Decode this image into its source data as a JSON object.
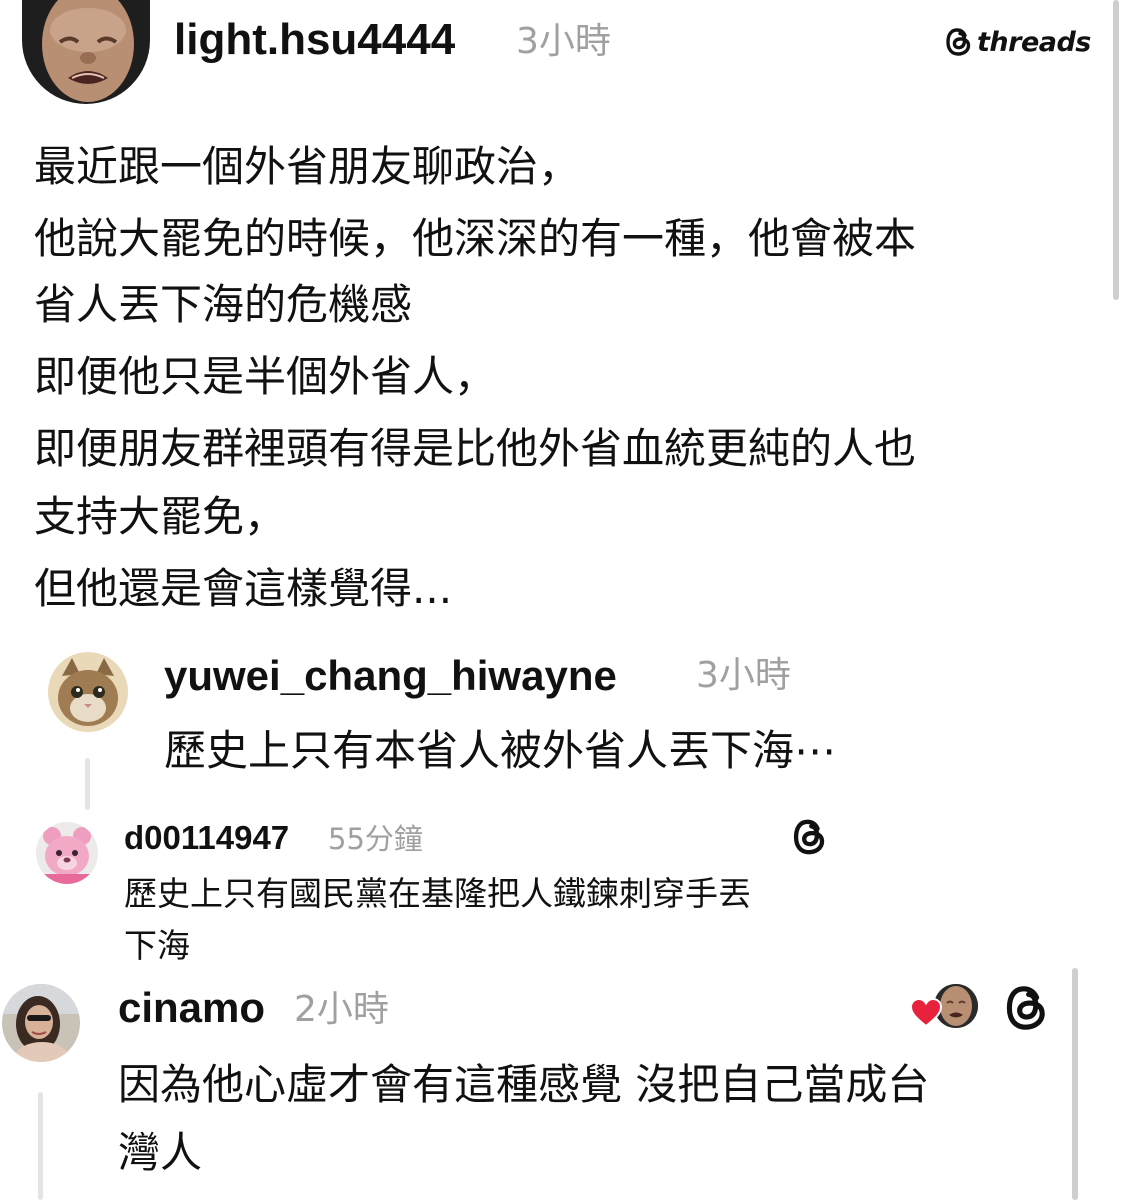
{
  "brand": {
    "icon": "threads-logo-icon",
    "label": "threads"
  },
  "post": {
    "author": "light.hsu4444",
    "time": "3小時",
    "avatar": "crying-baby-avatar",
    "lines": [
      "最近跟一個外省朋友聊政治，",
      "他說大罷免的時候，他深深的有一種，他會被本",
      "省人丟下海的危機感",
      "即便他只是半個外省人，",
      "即便朋友群裡頭有得是比他外省血統更純的人也",
      "支持大罷免，",
      "但他還是會這樣覺得..."
    ]
  },
  "replies": [
    {
      "author": "yuwei_chang_hiwayne",
      "time": "3小時",
      "avatar": "cat-avatar",
      "lines": [
        "歷史上只有本省人被外省人丟下海⋯"
      ]
    },
    {
      "author": "d00114947",
      "time": "55分鐘",
      "avatar": "pink-bear-avatar",
      "badge_icon": "threads-logo-icon",
      "lines": [
        "歷史上只有國民黨在基隆把人鐵鍊刺穿手丟",
        "下海"
      ]
    },
    {
      "author": "cinamo",
      "time": "2小時",
      "avatar": "woman-photo-avatar",
      "liked_by_icon": "heart-icon",
      "badge_icon": "threads-logo-icon",
      "lines": [
        "因為他心虛才會有這種感覺 沒把自己當成台",
        "灣人"
      ]
    }
  ],
  "colors": {
    "text": "#111111",
    "timestamp": "#a0a0a0",
    "like_heart": "#e8213c",
    "thread_line": "#e4e4e4"
  }
}
